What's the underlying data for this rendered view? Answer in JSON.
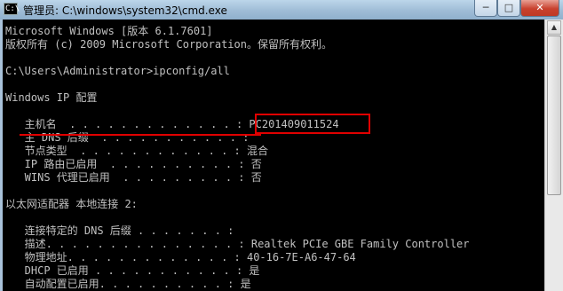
{
  "window": {
    "title": "管理员: C:\\windows\\system32\\cmd.exe",
    "app_icon": "C:\\",
    "controls": {
      "minimize": "─",
      "maximize": "□",
      "close": "✕"
    }
  },
  "console": {
    "lines": [
      "Microsoft Windows [版本 6.1.7601]",
      "版权所有 (c) 2009 Microsoft Corporation。保留所有权利。",
      "",
      "C:\\Users\\Administrator>ipconfig/all",
      "",
      "Windows IP 配置",
      "",
      "   主机名  . . . . . . . . . . . . . : PC201409011524",
      "   主 DNS 后缀  . . . . . . . . . . . :",
      "   节点类型  . . . . . . . . . . . . : 混合",
      "   IP 路由已启用  . . . . . . . . . . : 否",
      "   WINS 代理已启用  . . . . . . . . . : 否",
      "",
      "以太网适配器 本地连接 2:",
      "",
      "   连接特定的 DNS 后缀 . . . . . . . :",
      "   描述. . . . . . . . . . . . . . . : Realtek PCIe GBE Family Controller",
      "   物理地址. . . . . . . . . . . . . : 40-16-7E-A6-47-64",
      "   DHCP 已启用 . . . . . . . . . . . : 是",
      "   自动配置已启用. . . . . . . . . . : 是"
    ]
  },
  "colors": {
    "console_bg": "#000000",
    "console_fg": "#c0c0c0",
    "annotation": "#e00000"
  }
}
